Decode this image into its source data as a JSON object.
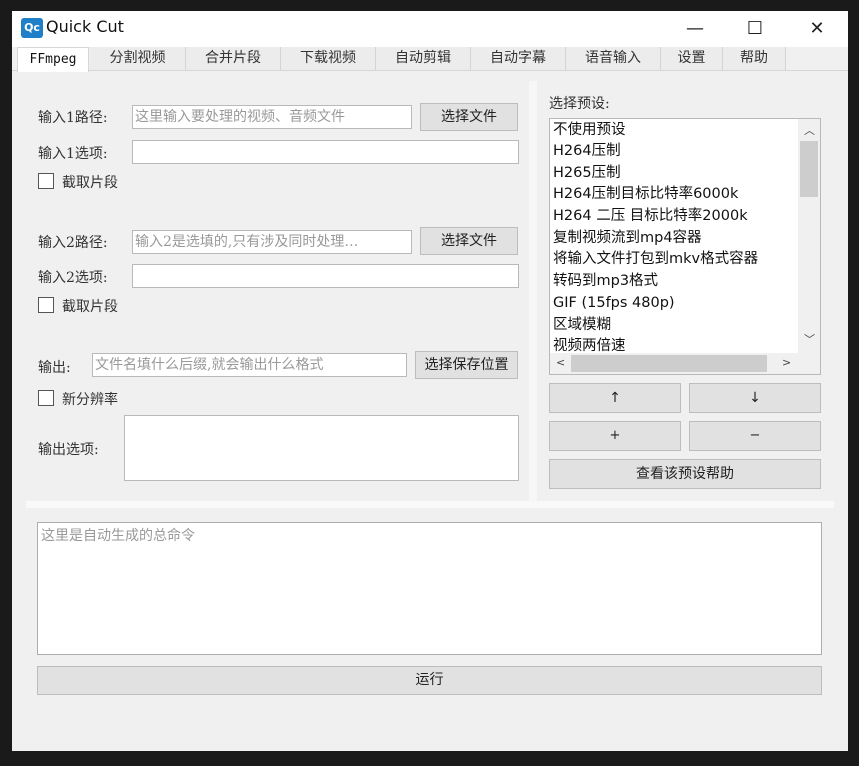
{
  "app": {
    "icon_text": "Qc",
    "title": "Quick Cut",
    "minimize": "—",
    "maximize": "☐",
    "close": "✕"
  },
  "tabs": [
    "FFmpeg",
    "分割视频",
    "合并片段",
    "下载视频",
    "自动剪辑",
    "自动字幕",
    "语音输入",
    "设置",
    "帮助"
  ],
  "left": {
    "input1_label": "输入1路径:",
    "input1_placeholder": "这里输入要处理的视频、音频文件",
    "input1_button": "选择文件",
    "input1_options_label": "输入1选项:",
    "input1_options_value": "",
    "input1_clip_label": "截取片段",
    "input2_label": "输入2路径:",
    "input2_placeholder": "输入2是选填的,只有涉及同时处理…",
    "input2_button": "选择文件",
    "input2_options_label": "输入2选项:",
    "input2_options_value": "",
    "input2_clip_label": "截取片段",
    "output_label": "输出:",
    "output_placeholder": "文件名填什么后缀,就会输出什么格式",
    "output_button": "选择保存位置",
    "resolution_label": "新分辨率",
    "output_options_label": "输出选项:"
  },
  "right": {
    "preset_label": "选择预设:",
    "presets": [
      "不使用预设",
      "H264压制",
      "H265压制",
      "H264压制目标比特率6000k",
      "H264 二压 目标比特率2000k",
      "复制视频流到mp4容器",
      "将输入文件打包到mkv格式容器",
      "转码到mp3格式",
      "GIF (15fps 480p)",
      "区域模糊",
      "视频两倍速"
    ],
    "up_button": "↑",
    "down_button": "↓",
    "add_button": "+",
    "remove_button": "−",
    "help_button": "查看该预设帮助"
  },
  "command": {
    "placeholder": "这里是自动生成的总命令",
    "run_button": "运行"
  }
}
